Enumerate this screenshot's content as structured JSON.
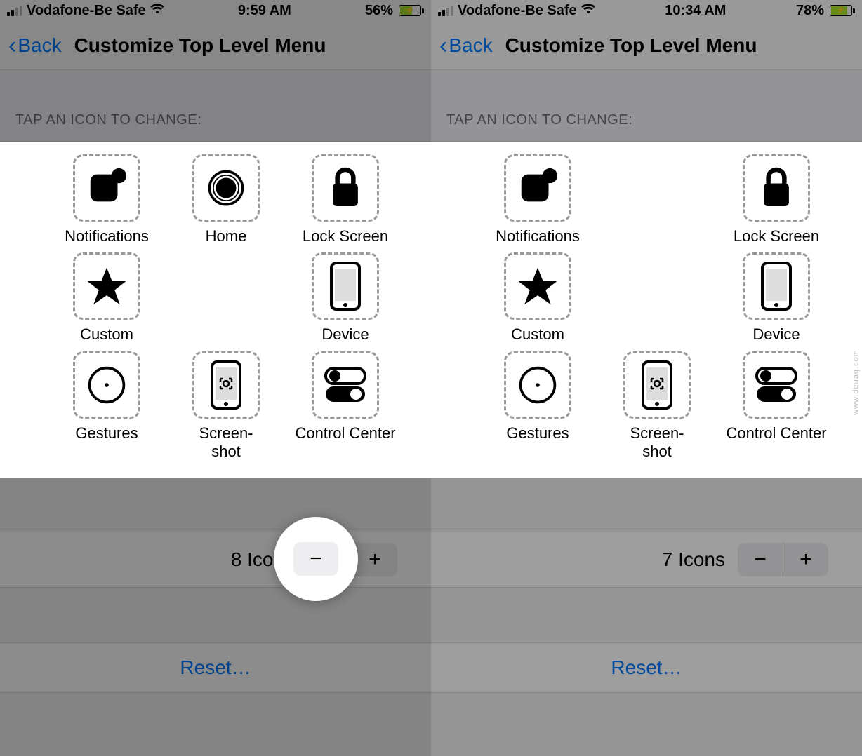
{
  "watermark": "www.deuaq.com",
  "left": {
    "status": {
      "carrier": "Vodafone-Be Safe",
      "time": "9:59 AM",
      "battery_pct": "56%"
    },
    "nav": {
      "back_label": "Back",
      "title": "Customize Top Level Menu"
    },
    "section_label": "TAP AN ICON TO CHANGE:",
    "icons": [
      {
        "name": "notifications",
        "label": "Notifications"
      },
      {
        "name": "home",
        "label": "Home"
      },
      {
        "name": "lock-screen",
        "label": "Lock Screen"
      },
      {
        "name": "custom",
        "label": "Custom"
      },
      {
        "name": "empty",
        "label": ""
      },
      {
        "name": "device",
        "label": "Device"
      },
      {
        "name": "gestures",
        "label": "Gestures"
      },
      {
        "name": "screenshot",
        "label": "Screen-\nshot"
      },
      {
        "name": "control-center",
        "label": "Control Center"
      }
    ],
    "count_label": "8 Icons",
    "reset_label": "Reset…"
  },
  "right": {
    "status": {
      "carrier": "Vodafone-Be Safe",
      "time": "10:34 AM",
      "battery_pct": "78%"
    },
    "nav": {
      "back_label": "Back",
      "title": "Customize Top Level Menu"
    },
    "section_label": "TAP AN ICON TO CHANGE:",
    "icons": [
      {
        "name": "notifications",
        "label": "Notifications"
      },
      {
        "name": "empty",
        "label": ""
      },
      {
        "name": "lock-screen",
        "label": "Lock Screen"
      },
      {
        "name": "custom",
        "label": "Custom"
      },
      {
        "name": "empty",
        "label": ""
      },
      {
        "name": "device",
        "label": "Device"
      },
      {
        "name": "gestures",
        "label": "Gestures"
      },
      {
        "name": "screenshot",
        "label": "Screen-\nshot"
      },
      {
        "name": "control-center",
        "label": "Control Center"
      }
    ],
    "count_label": "7 Icons",
    "reset_label": "Reset…"
  }
}
